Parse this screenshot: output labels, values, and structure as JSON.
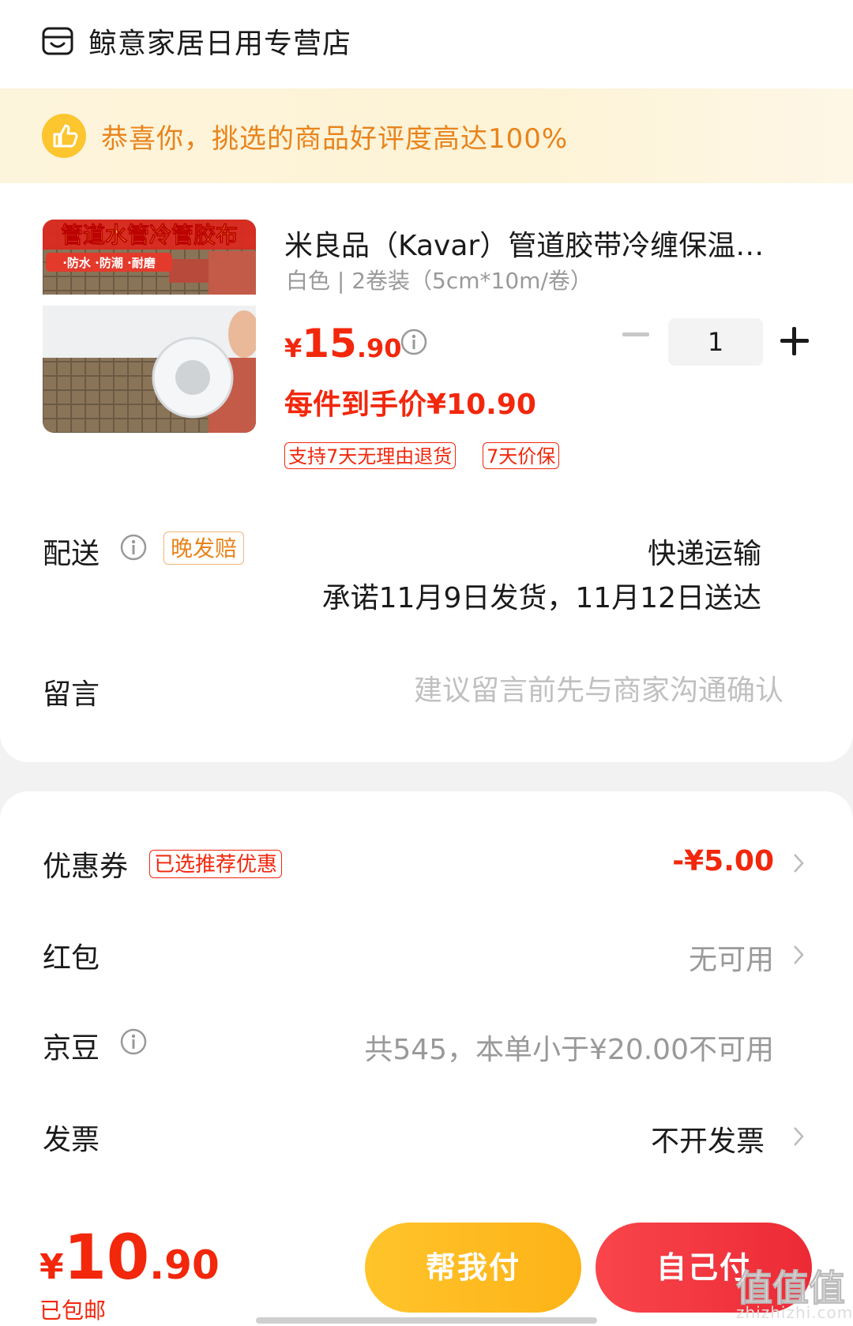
{
  "store": {
    "name": "鲸意家居日用专营店"
  },
  "banner": {
    "text": "恭喜你，挑选的商品好评度高达100%"
  },
  "product": {
    "image_caption": "管道水管冷管胶布",
    "image_sub": "·防水 ·防潮 ·耐磨",
    "title": "米良品（Kavar）管道胶带冷缠保温…",
    "spec": "白色 | 2卷装（5cm*10m/卷）",
    "price_symbol": "¥",
    "price_int": "15",
    "price_dec": ".90",
    "final_price": "每件到手价¥10.90",
    "tags": [
      "支持7天无理由退货",
      "7天价保"
    ],
    "quantity": "1"
  },
  "delivery": {
    "label": "配送",
    "badge": "晚发赔",
    "method": "快递运输",
    "promise": "承诺11月9日发货，11月12日送达"
  },
  "message": {
    "label": "留言",
    "placeholder": "建议留言前先与商家沟通确认"
  },
  "options": {
    "coupon": {
      "label": "优惠券",
      "tag": "已选推荐优惠",
      "value": "-¥5.00"
    },
    "redpacket": {
      "label": "红包",
      "value": "无可用"
    },
    "jingdou": {
      "label": "京豆",
      "value": "共545，本单小于¥20.00不可用"
    },
    "invoice": {
      "label": "发票",
      "value": "不开发票"
    }
  },
  "footer": {
    "total_symbol": "¥",
    "total_int": "10",
    "total_dec": ".90",
    "shipping": "已包邮",
    "help_pay_label": "帮我付",
    "self_pay_label": "自己付"
  },
  "watermark": {
    "text": "值值值",
    "sub": "zhizhizhi.com"
  },
  "colors": {
    "accent_red": "#f2270c",
    "banner_orange": "#e8841c",
    "help_yellow": "#fdb317",
    "pay_red": "#ec2a35"
  }
}
